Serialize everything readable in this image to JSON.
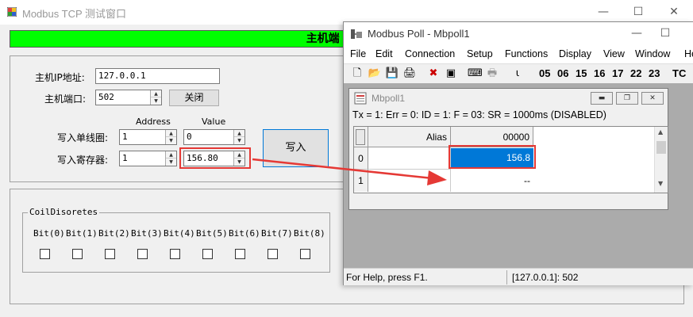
{
  "slave_window": {
    "title": "Modbus TCP 测试窗口",
    "banner": "主机端 (Slave)",
    "ip_label": "主机IP地址:",
    "ip_value": "127.0.0.1",
    "port_label": "主机端口:",
    "port_value": "502",
    "close_button": "关闭",
    "address_header": "Address",
    "value_header": "Value",
    "write_coil_label": "写入单线圈:",
    "write_coil_address": "1",
    "write_coil_value": "0",
    "write_reg_label": "写入寄存器:",
    "write_reg_address": "1",
    "write_reg_value": "156.80",
    "write_button": "写入",
    "coil_group_title": "CoilDisoretes",
    "bits": [
      "Bit(0)",
      "Bit(1)",
      "Bit(2)",
      "Bit(3)",
      "Bit(4)",
      "Bit(5)",
      "Bit(6)",
      "Bit(7)",
      "Bit(8)"
    ]
  },
  "poll_window": {
    "title": "Modbus Poll - Mbpoll1",
    "menu": [
      "File",
      "Edit",
      "Connection",
      "Setup",
      "Functions",
      "Display",
      "View",
      "Window",
      "He"
    ],
    "toolbar_codes": [
      "05",
      "06",
      "15",
      "16",
      "17",
      "22",
      "23",
      "TC"
    ],
    "child_title": "Mbpoll1",
    "status_line": "Tx = 1: Err = 0: ID = 1: F = 03: SR = 1000ms  (DISABLED)",
    "grid": {
      "col_alias": "Alias",
      "col_value": "00000",
      "rows": [
        {
          "index": "0",
          "value": "156.8"
        },
        {
          "index": "1",
          "value": "--"
        }
      ]
    },
    "status_help": "For Help, press F1.",
    "status_conn": "[127.0.0.1]: 502"
  },
  "colors": {
    "banner": "#00ff00",
    "annotation": "#e53935",
    "selected_cell": "#0078d7"
  }
}
